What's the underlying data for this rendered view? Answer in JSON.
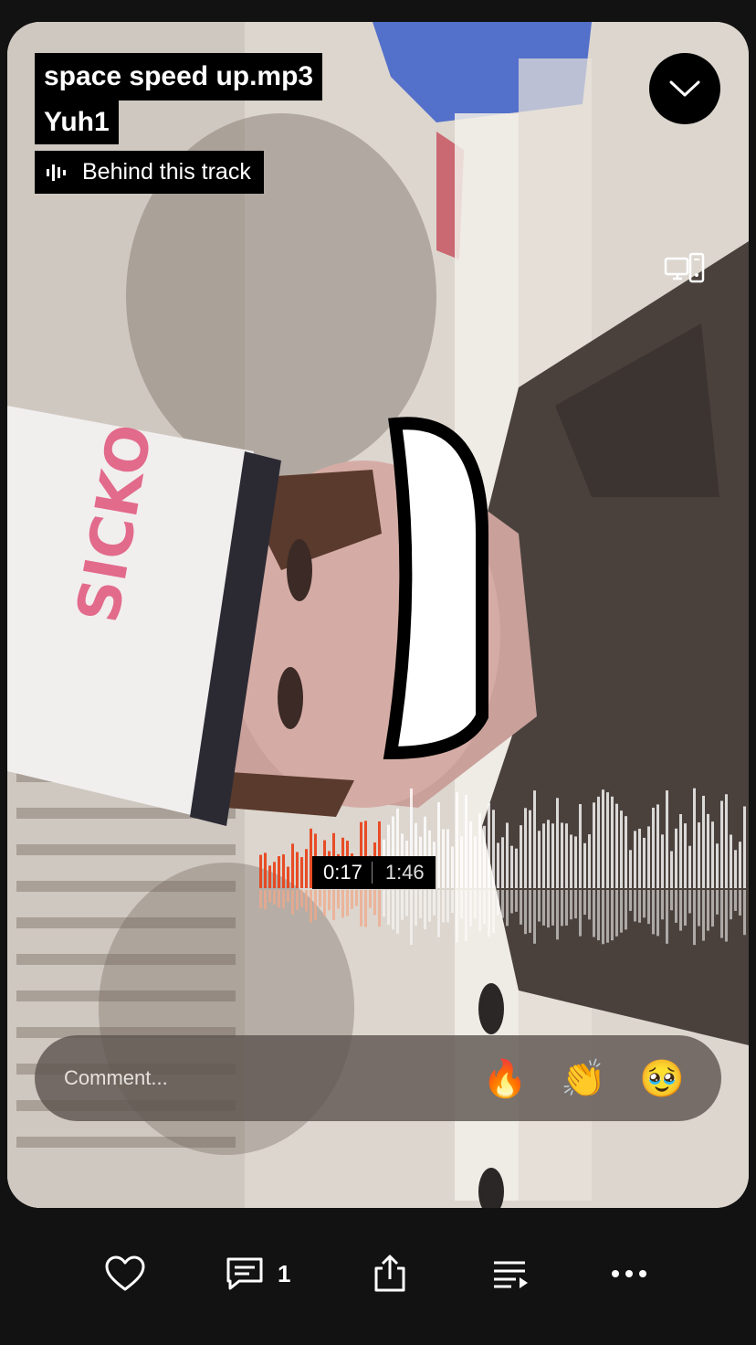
{
  "track": {
    "title": "space speed up.mp3",
    "artist": "Yuh1",
    "behind_label": "Behind this track"
  },
  "header": {
    "collapse_icon": "chevron-down-icon",
    "cast_icon": "cast-devices-icon"
  },
  "player": {
    "current_time": "0:17",
    "duration": "1:46",
    "progress": 0.16,
    "played_color": "#e8451c",
    "unplayed_color": "#ffffff"
  },
  "comment": {
    "placeholder": "Comment...",
    "reactions": [
      "🔥",
      "👏",
      "🥹"
    ]
  },
  "bottom_bar": {
    "like_icon": "heart-icon",
    "comment_icon": "comment-icon",
    "comment_count": "1",
    "share_icon": "share-icon",
    "queue_icon": "queue-icon",
    "more_icon": "more-icon"
  }
}
